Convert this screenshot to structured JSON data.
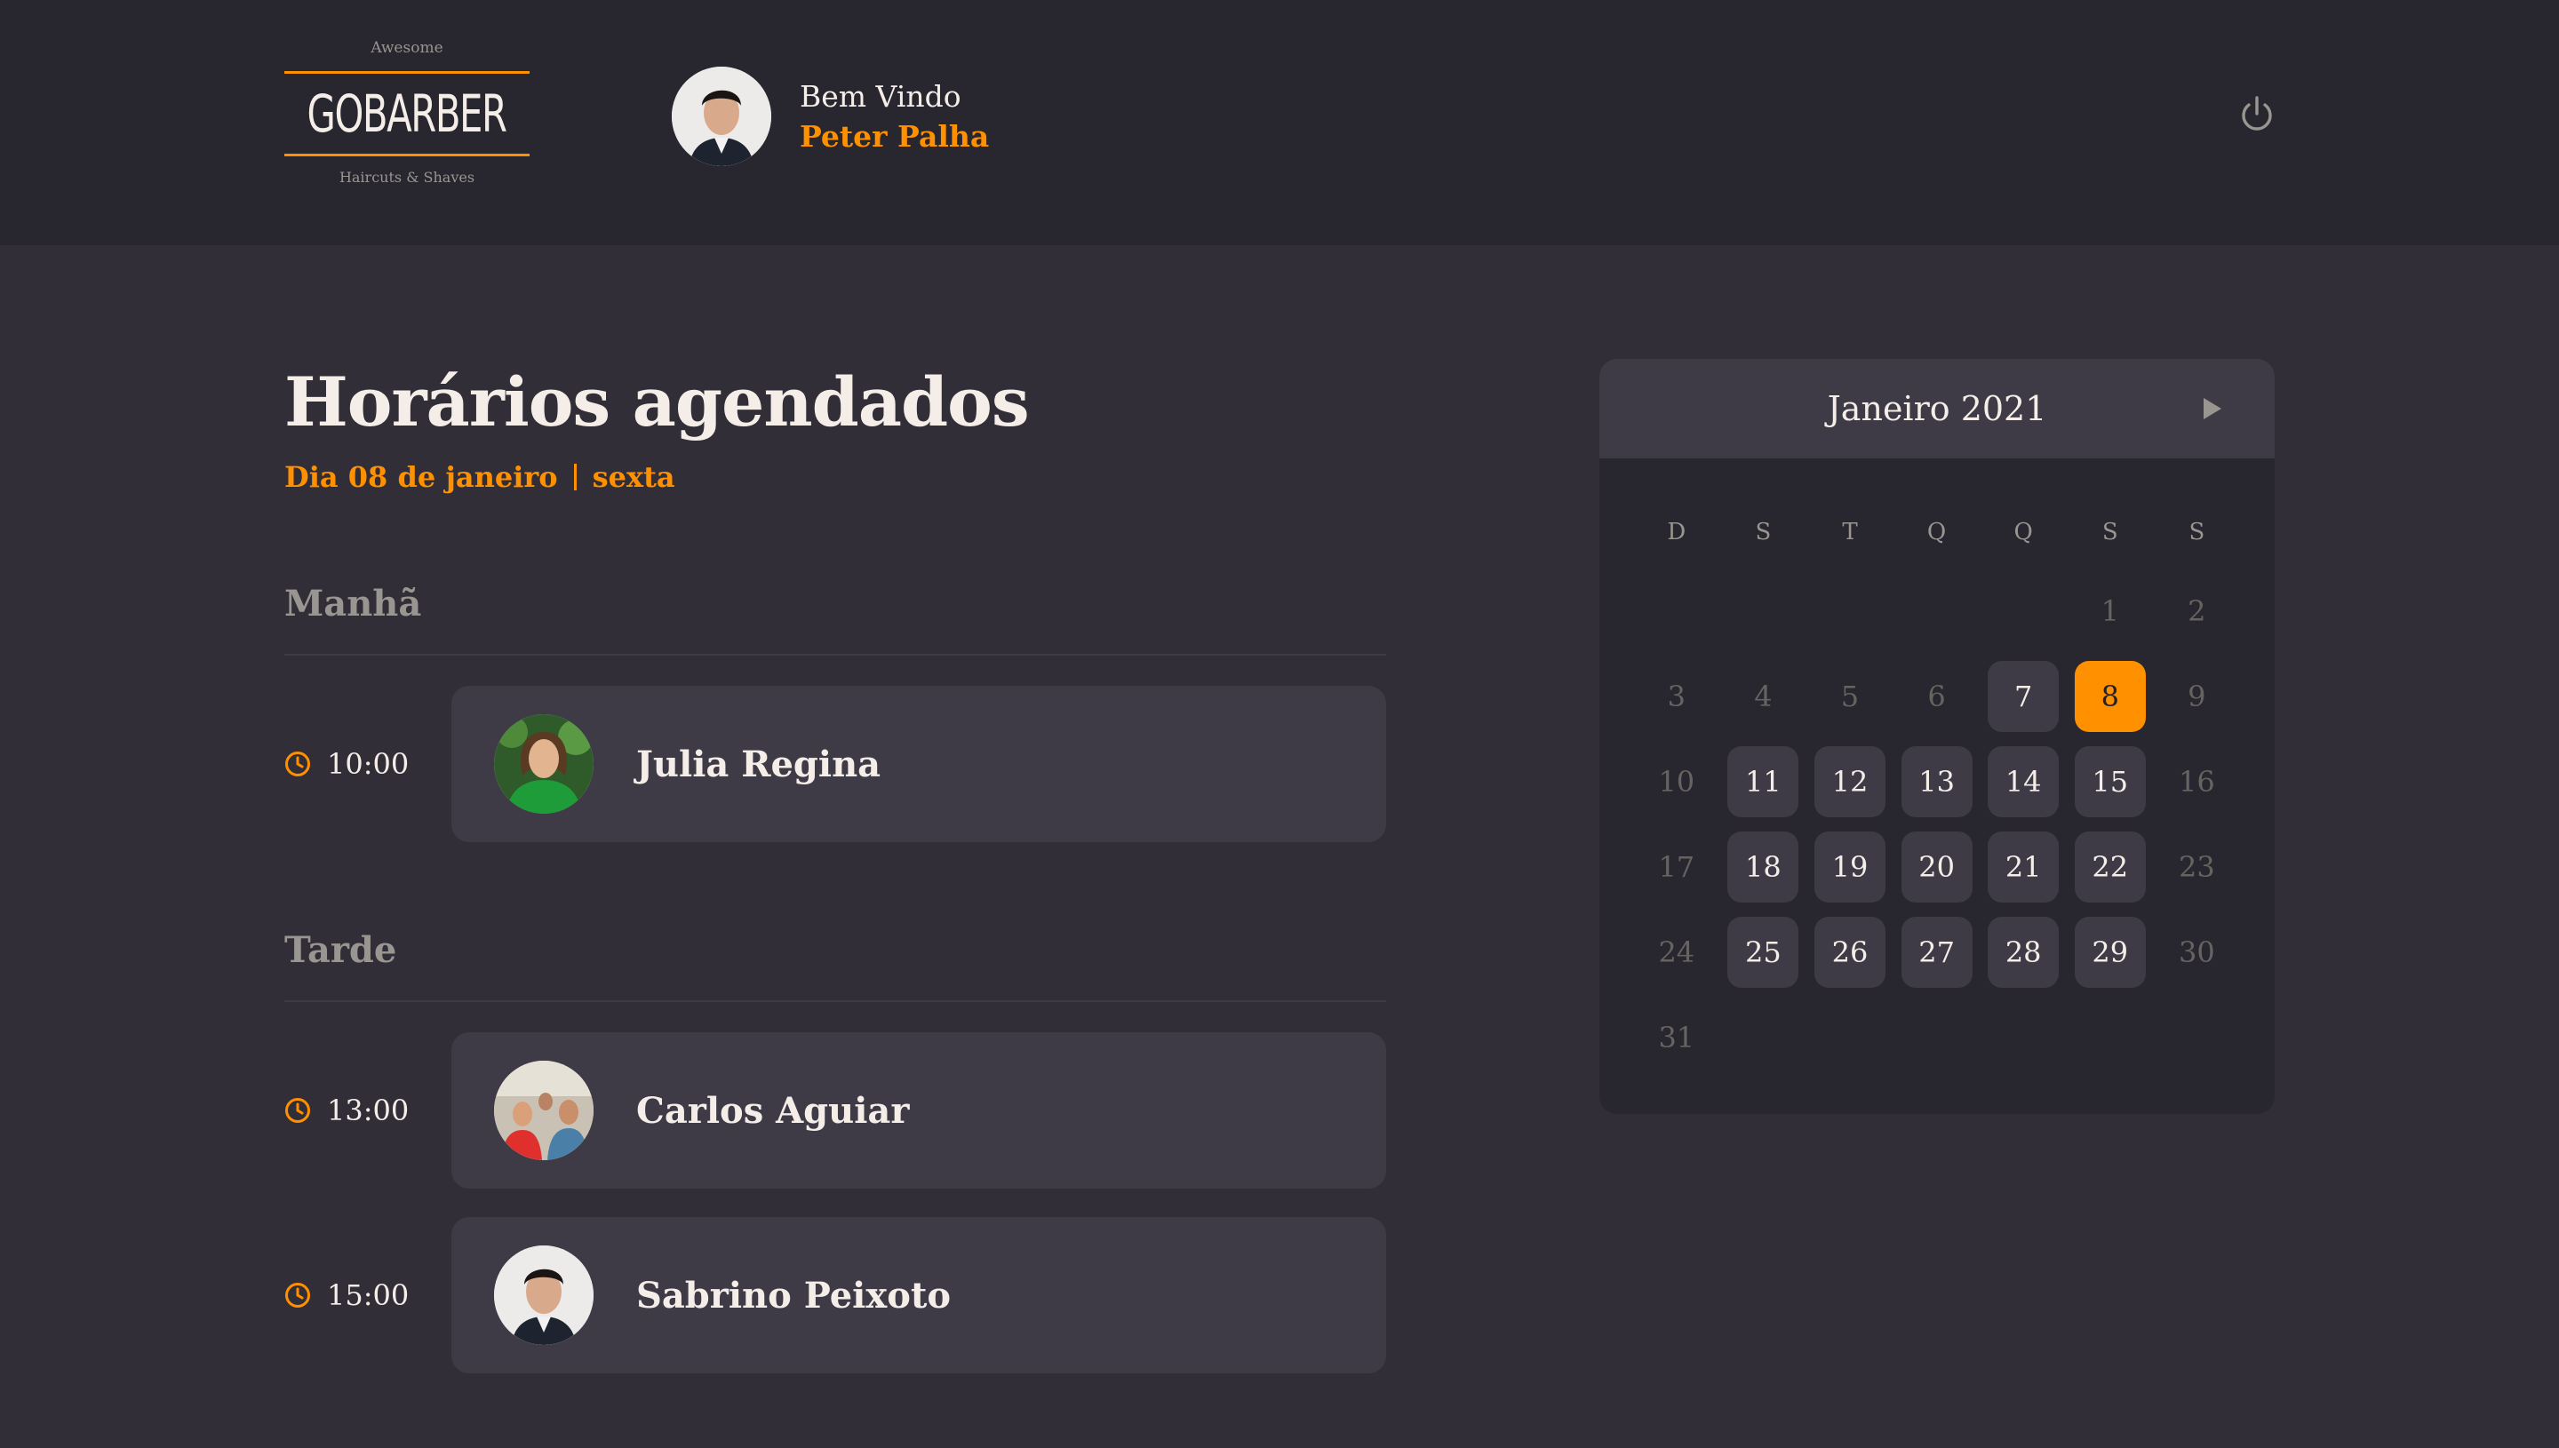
{
  "header": {
    "logo": {
      "top": "Awesome",
      "brand": "GOBARBER",
      "bottom": "Haircuts & Shaves"
    },
    "welcome_label": "Bem Vindo",
    "user_name": "Peter Palha",
    "logout_icon": "power-icon"
  },
  "main": {
    "title": "Horários agendados",
    "date_label": "Dia 08 de janeiro",
    "weekday_label": "sexta",
    "sections": [
      {
        "title": "Manhã"
      },
      {
        "title": "Tarde"
      }
    ],
    "appointments": [
      {
        "time": "10:00",
        "name": "Julia Regina"
      },
      {
        "time": "13:00",
        "name": "Carlos Aguiar"
      },
      {
        "time": "15:00",
        "name": "Sabrino Peixoto"
      }
    ]
  },
  "calendar": {
    "month_label": "Janeiro 2021",
    "weekdays": [
      "D",
      "S",
      "T",
      "Q",
      "Q",
      "S",
      "S"
    ],
    "selected_day": 8,
    "weeks": [
      [
        null,
        null,
        null,
        null,
        null,
        "1",
        "2"
      ],
      [
        "3",
        "4",
        "5",
        "6",
        "7",
        "8",
        "9"
      ],
      [
        "10",
        "11",
        "12",
        "13",
        "14",
        "15",
        "16"
      ],
      [
        "17",
        "18",
        "19",
        "20",
        "21",
        "22",
        "23"
      ],
      [
        "24",
        "25",
        "26",
        "27",
        "28",
        "29",
        "30"
      ],
      [
        "31",
        null,
        null,
        null,
        null,
        null,
        null
      ]
    ],
    "available_days": [
      7,
      8,
      11,
      12,
      13,
      14,
      15,
      18,
      19,
      20,
      21,
      22,
      25,
      26,
      27,
      28,
      29
    ]
  },
  "colors": {
    "accent": "#ff9000",
    "background": "#312e38",
    "header_bg": "#28262e",
    "card_bg": "#3e3b47",
    "text": "#f4ede8",
    "muted": "#999591"
  }
}
